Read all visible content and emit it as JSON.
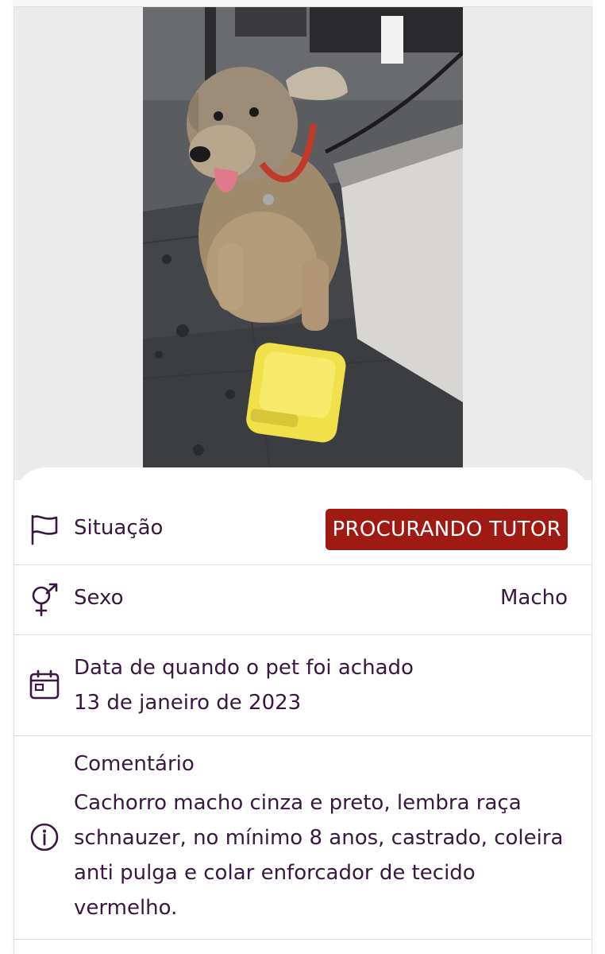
{
  "pet": {
    "photo": {
      "subject": "dog",
      "bowl_color": "#f0e04a"
    }
  },
  "details": {
    "situacao": {
      "icon": "flag-icon",
      "label": "Situação",
      "value": "PROCURANDO TUTOR",
      "badge_color": "#9e1a12"
    },
    "sexo": {
      "icon": "gender-icon",
      "label": "Sexo",
      "value": "Macho"
    },
    "data": {
      "icon": "calendar-icon",
      "label": "Data de quando o pet foi achado",
      "value": "13 de janeiro de 2023"
    },
    "comentario": {
      "icon": "info-icon",
      "label": "Comentário",
      "value": "Cachorro macho cinza e preto, lembra raça schnauzer, no mínimo 8 anos, castrado, coleira anti pulga e colar enforcador de tecido vermelho."
    }
  },
  "colors": {
    "text": "#3a1740",
    "badge": "#9e1a12",
    "divider": "#dadada",
    "photo_background": "#ebebeb"
  }
}
